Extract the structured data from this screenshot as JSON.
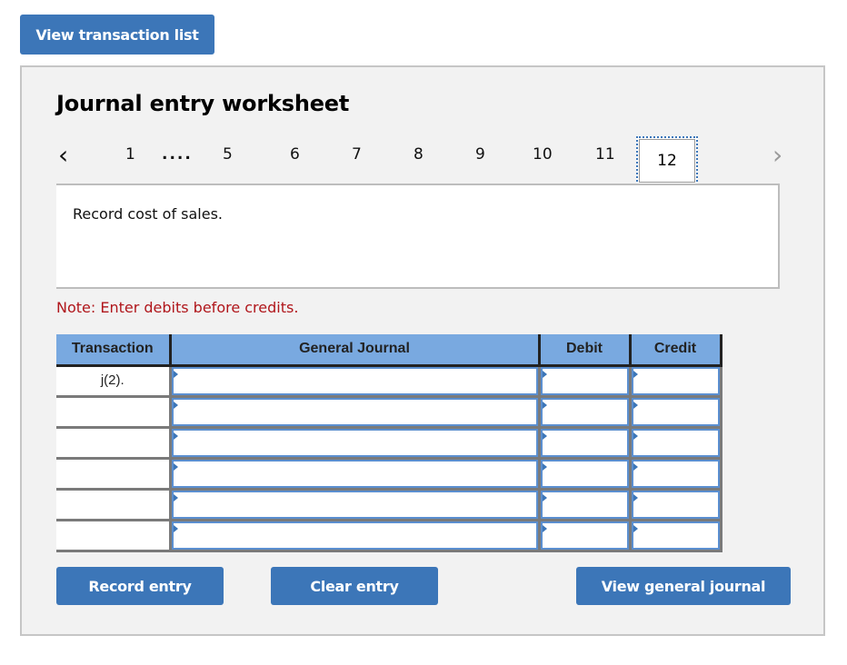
{
  "top_button": {
    "label": "View transaction list"
  },
  "worksheet": {
    "title": "Journal entry worksheet",
    "pager": {
      "prev_icon": "chevron-left-icon",
      "next_icon": "chevron-right-icon",
      "pages": [
        "1",
        "....",
        "5",
        "6",
        "7",
        "8",
        "9",
        "10",
        "11"
      ],
      "active_page": "12"
    },
    "prompt": "Record cost of sales.",
    "note": "Note: Enter debits before credits.",
    "table": {
      "headers": {
        "transaction": "Transaction",
        "general_journal": "General Journal",
        "debit": "Debit",
        "credit": "Credit"
      },
      "rows": [
        {
          "transaction": "j(2).",
          "account": "",
          "debit": "",
          "credit": ""
        },
        {
          "transaction": "",
          "account": "",
          "debit": "",
          "credit": ""
        },
        {
          "transaction": "",
          "account": "",
          "debit": "",
          "credit": ""
        },
        {
          "transaction": "",
          "account": "",
          "debit": "",
          "credit": ""
        },
        {
          "transaction": "",
          "account": "",
          "debit": "",
          "credit": ""
        },
        {
          "transaction": "",
          "account": "",
          "debit": "",
          "credit": ""
        }
      ]
    },
    "buttons": {
      "record": "Record entry",
      "clear": "Clear entry",
      "view_general_journal": "View general journal"
    }
  },
  "colors": {
    "button_blue": "#3c76b8",
    "header_blue": "#79a9e0",
    "note_red": "#b0161b",
    "panel_bg": "#f2f2f2"
  }
}
